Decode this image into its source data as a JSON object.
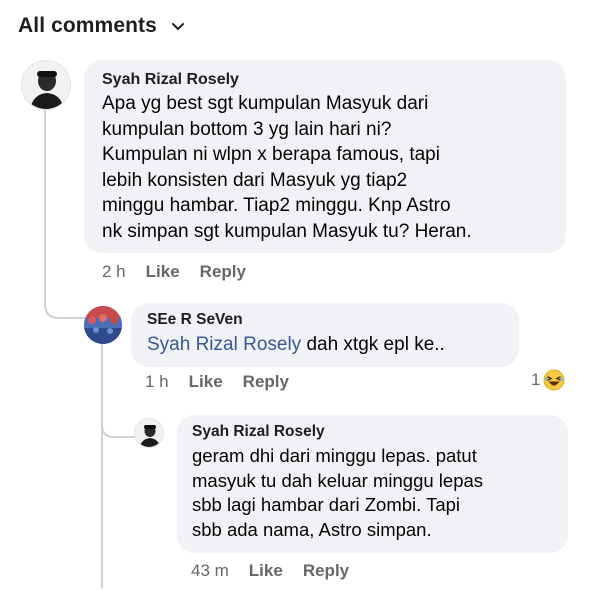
{
  "header": {
    "title": "All comments",
    "toggle_icon": "chevron-down-icon"
  },
  "comments": [
    {
      "author": "Syah Rizal Rosely",
      "lines": [
        "Apa yg best sgt kumpulan Masyuk dari",
        "kumpulan bottom 3 yg lain hari ni?",
        "Kumpulan ni wlpn x berapa famous, tapi",
        "lebih konsisten dari Masyuk yg tiap2",
        "minggu hambar. Tiap2 minggu. Knp Astro",
        "nk simpan sgt kumpulan Masyuk tu? Heran."
      ],
      "time": "2 h",
      "like": "Like",
      "reply": "Reply"
    },
    {
      "author": "SEe R SeVen",
      "mention": "Syah Rizal Rosely",
      "text": " dah xtgk epl ke..",
      "time": "1 h",
      "like": "Like",
      "reply": "Reply",
      "reaction_count": "1",
      "reaction_icon": "laughing-emoji-icon"
    },
    {
      "author": "Syah Rizal Rosely",
      "lines": [
        "geram dhi dari minggu lepas. patut",
        "masyuk tu dah keluar minggu lepas",
        "sbb lagi hambar dari Zombi. Tapi",
        "sbb ada nama, Astro simpan."
      ],
      "time": "43 m",
      "like": "Like",
      "reply": "Reply"
    }
  ],
  "colors": {
    "bubble": "#f0f2f5",
    "mention": "#385898",
    "meta": "#65676b",
    "thread_line": "#ced0d4"
  }
}
